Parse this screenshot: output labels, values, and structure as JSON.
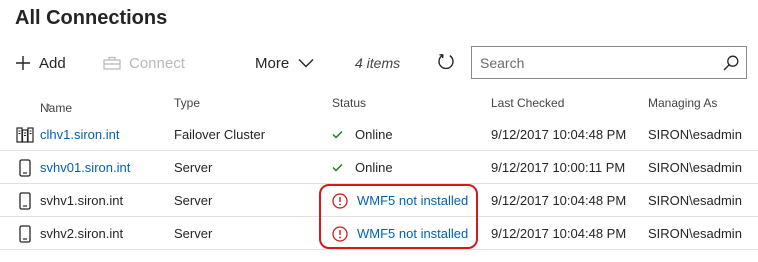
{
  "header": {
    "title": "All Connections"
  },
  "toolbar": {
    "add_label": "Add",
    "connect_label": "Connect",
    "more_label": "More",
    "item_count": "4 items"
  },
  "search": {
    "placeholder": "Search",
    "value": ""
  },
  "columns": {
    "name": "Name",
    "type": "Type",
    "status": "Status",
    "last_checked": "Last Checked",
    "managing_as": "Managing As"
  },
  "rows": [
    {
      "icon": "cluster-icon",
      "name": "clhv1.siron.int",
      "name_is_link": true,
      "type": "Failover Cluster",
      "status": "Online",
      "status_kind": "ok",
      "last_checked": "9/12/2017 10:04:48 PM",
      "managing_as": "SIRON\\esadmin"
    },
    {
      "icon": "server-icon",
      "name": "svhv01.siron.int",
      "name_is_link": true,
      "type": "Server",
      "status": "Online",
      "status_kind": "ok",
      "last_checked": "9/12/2017 10:00:11 PM",
      "managing_as": "SIRON\\esadmin"
    },
    {
      "icon": "server-icon",
      "name": "svhv1.siron.int",
      "name_is_link": false,
      "type": "Server",
      "status": "WMF5 not installed",
      "status_kind": "warning",
      "last_checked": "9/12/2017 10:04:48 PM",
      "managing_as": "SIRON\\esadmin"
    },
    {
      "icon": "server-icon",
      "name": "svhv2.siron.int",
      "name_is_link": false,
      "type": "Server",
      "status": "WMF5 not installed",
      "status_kind": "warning",
      "last_checked": "9/12/2017 10:04:48 PM",
      "managing_as": "SIRON\\esadmin"
    }
  ],
  "colors": {
    "link": "#0063b1",
    "ok_check": "#107c10",
    "warning": "#d81818",
    "highlight_annotation": "#d81818",
    "disabled_text": "#b8b8b8"
  }
}
